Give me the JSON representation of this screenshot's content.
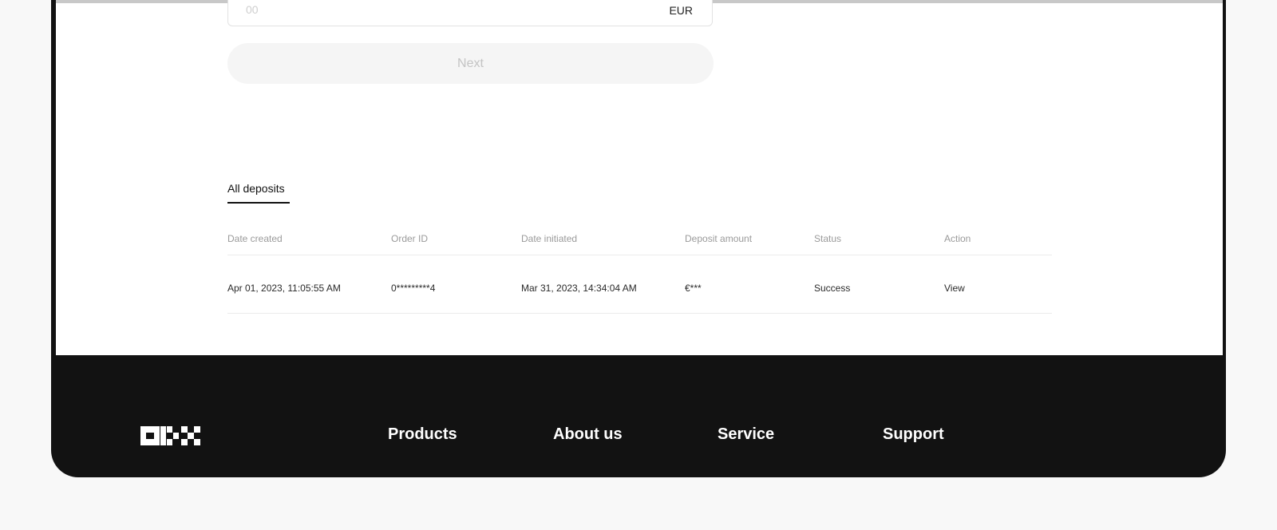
{
  "deposit_form": {
    "amount_placeholder": "00",
    "currency": "EUR",
    "next_label": "Next"
  },
  "deposits": {
    "tab_label": "All deposits",
    "columns": [
      "Date created",
      "Order ID",
      "Date initiated",
      "Deposit amount",
      "Status",
      "Action"
    ],
    "rows": [
      {
        "date_created": "Apr 01, 2023, 11:05:55 AM",
        "order_id": "0*********4",
        "date_initiated": "Mar 31, 2023, 14:34:04 AM",
        "deposit_amount": "€***",
        "status": "Success",
        "action": "View"
      }
    ]
  },
  "footer": {
    "logo_icon": "okx-logo",
    "links": [
      "Products",
      "About us",
      "Service",
      "Support"
    ]
  },
  "colors": {
    "footer_bg": "#121212",
    "page_bg": "#f8f8f8",
    "button_disabled_bg": "#f5f5f5"
  }
}
